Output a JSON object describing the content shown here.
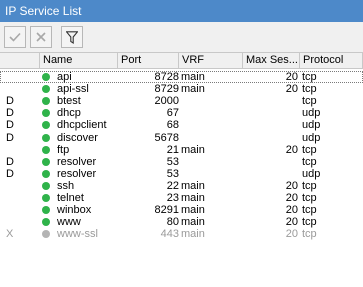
{
  "window": {
    "title": "IP Service List"
  },
  "toolbar": {
    "enable": {
      "icon": "check-icon"
    },
    "disable": {
      "icon": "x-icon"
    },
    "filter": {
      "icon": "filter-icon"
    }
  },
  "table": {
    "columns": {
      "name": "Name",
      "port": "Port",
      "vrf": "VRF",
      "max_sessions": "Max Ses...",
      "protocol": "Protocol"
    },
    "status_colors": {
      "enabled": "#2fb34a",
      "disabled": "#b4b4b4"
    },
    "rows": [
      {
        "flag": "",
        "name": "api",
        "port": "8728",
        "vrf": "main",
        "max": "20",
        "proto": "tcp",
        "enabled": true
      },
      {
        "flag": "",
        "name": "api-ssl",
        "port": "8729",
        "vrf": "main",
        "max": "20",
        "proto": "tcp",
        "enabled": true
      },
      {
        "flag": "D",
        "name": "btest",
        "port": "2000",
        "vrf": "",
        "max": "",
        "proto": "tcp",
        "enabled": true
      },
      {
        "flag": "D",
        "name": "dhcp",
        "port": "67",
        "vrf": "",
        "max": "",
        "proto": "udp",
        "enabled": true
      },
      {
        "flag": "D",
        "name": "dhcpclient",
        "port": "68",
        "vrf": "",
        "max": "",
        "proto": "udp",
        "enabled": true
      },
      {
        "flag": "D",
        "name": "discover",
        "port": "5678",
        "vrf": "",
        "max": "",
        "proto": "udp",
        "enabled": true
      },
      {
        "flag": "",
        "name": "ftp",
        "port": "21",
        "vrf": "main",
        "max": "20",
        "proto": "tcp",
        "enabled": true
      },
      {
        "flag": "D",
        "name": "resolver",
        "port": "53",
        "vrf": "",
        "max": "",
        "proto": "tcp",
        "enabled": true
      },
      {
        "flag": "D",
        "name": "resolver",
        "port": "53",
        "vrf": "",
        "max": "",
        "proto": "udp",
        "enabled": true
      },
      {
        "flag": "",
        "name": "ssh",
        "port": "22",
        "vrf": "main",
        "max": "20",
        "proto": "tcp",
        "enabled": true
      },
      {
        "flag": "",
        "name": "telnet",
        "port": "23",
        "vrf": "main",
        "max": "20",
        "proto": "tcp",
        "enabled": true
      },
      {
        "flag": "",
        "name": "winbox",
        "port": "8291",
        "vrf": "main",
        "max": "20",
        "proto": "tcp",
        "enabled": true
      },
      {
        "flag": "",
        "name": "www",
        "port": "80",
        "vrf": "main",
        "max": "20",
        "proto": "tcp",
        "enabled": true
      },
      {
        "flag": "X",
        "name": "www-ssl",
        "port": "443",
        "vrf": "main",
        "max": "20",
        "proto": "tcp",
        "enabled": false
      }
    ]
  }
}
